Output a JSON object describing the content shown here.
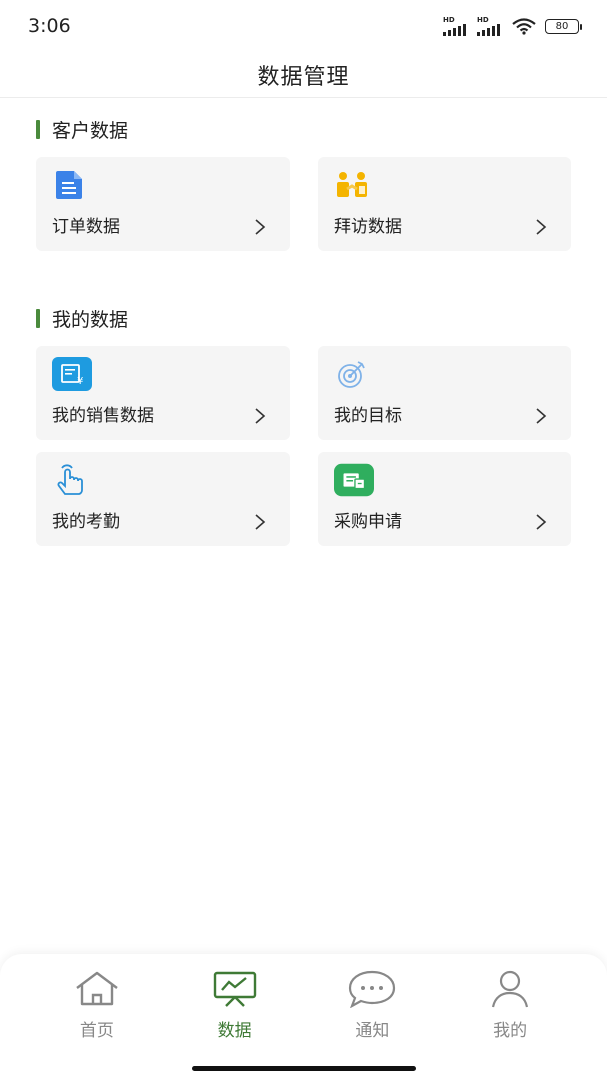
{
  "status": {
    "time": "3:06",
    "battery": "80",
    "hd1": "HD",
    "hd2": "HD"
  },
  "header": {
    "title": "数据管理"
  },
  "sections": [
    {
      "title": "客户数据",
      "items": [
        {
          "label": "订单数据",
          "icon": "document-icon"
        },
        {
          "label": "拜访数据",
          "icon": "handshake-icon"
        }
      ]
    },
    {
      "title": "我的数据",
      "items": [
        {
          "label": "我的销售数据",
          "icon": "sales-receipt-icon"
        },
        {
          "label": "我的目标",
          "icon": "target-icon"
        },
        {
          "label": "我的考勤",
          "icon": "touch-hand-icon"
        },
        {
          "label": "采购申请",
          "icon": "purchase-form-icon"
        }
      ]
    }
  ],
  "tabbar": {
    "tabs": [
      {
        "label": "首页",
        "icon": "home-icon",
        "active": false
      },
      {
        "label": "数据",
        "icon": "data-board-icon",
        "active": true
      },
      {
        "label": "通知",
        "icon": "chat-bubble-icon",
        "active": false
      },
      {
        "label": "我的",
        "icon": "user-icon",
        "active": false
      }
    ]
  },
  "colors": {
    "accent": "#3f7a36",
    "section_bar": "#4a8a3c",
    "card_bg": "#f5f5f5",
    "inactive": "#888888"
  }
}
